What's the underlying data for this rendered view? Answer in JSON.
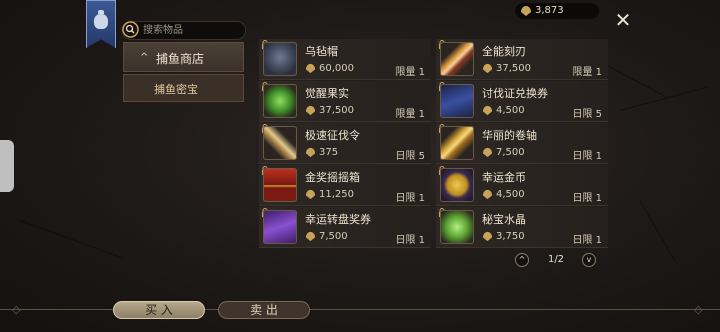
{
  "search": {
    "placeholder": "搜索物品"
  },
  "categories": [
    {
      "label": "捕鱼商店",
      "arrow": "^"
    },
    {
      "label": "捕鱼密宝"
    }
  ],
  "currency": {
    "amount": "3,873",
    "icon": "shell-coin-icon",
    "color": "#c9a35a"
  },
  "close_label": "✕",
  "items": [
    {
      "name": "乌毡帽",
      "price": "60,000",
      "limit": "限量 1",
      "icon": "hat-icon"
    },
    {
      "name": "全能刻刃",
      "price": "37,500",
      "limit": "限量 1",
      "icon": "blade-icon"
    },
    {
      "name": "觉醒果实",
      "price": "37,500",
      "limit": "限量 1",
      "icon": "fruit-icon"
    },
    {
      "name": "讨伐证兑换券",
      "price": "4,500",
      "limit": "日限 5",
      "icon": "voucher-icon"
    },
    {
      "name": "极速征伐令",
      "price": "375",
      "limit": "日限 5",
      "icon": "bone-icon"
    },
    {
      "name": "华丽的卷轴",
      "price": "7,500",
      "limit": "日限 1",
      "icon": "scroll-icon"
    },
    {
      "name": "金奖摇摇箱",
      "price": "11,250",
      "limit": "日限 1",
      "icon": "chest-icon"
    },
    {
      "name": "幸运金币",
      "price": "4,500",
      "limit": "日限 1",
      "icon": "gold-coin-icon"
    },
    {
      "name": "幸运转盘奖券",
      "price": "7,500",
      "limit": "日限 1",
      "icon": "ticket-icon"
    },
    {
      "name": "秘宝水晶",
      "price": "3,750",
      "limit": "日限 1",
      "icon": "crystal-icon"
    }
  ],
  "pagination": {
    "text": "1/2",
    "prev": "^",
    "next": "v"
  },
  "bottom": {
    "buy": "买 入",
    "sell": "卖 出"
  }
}
